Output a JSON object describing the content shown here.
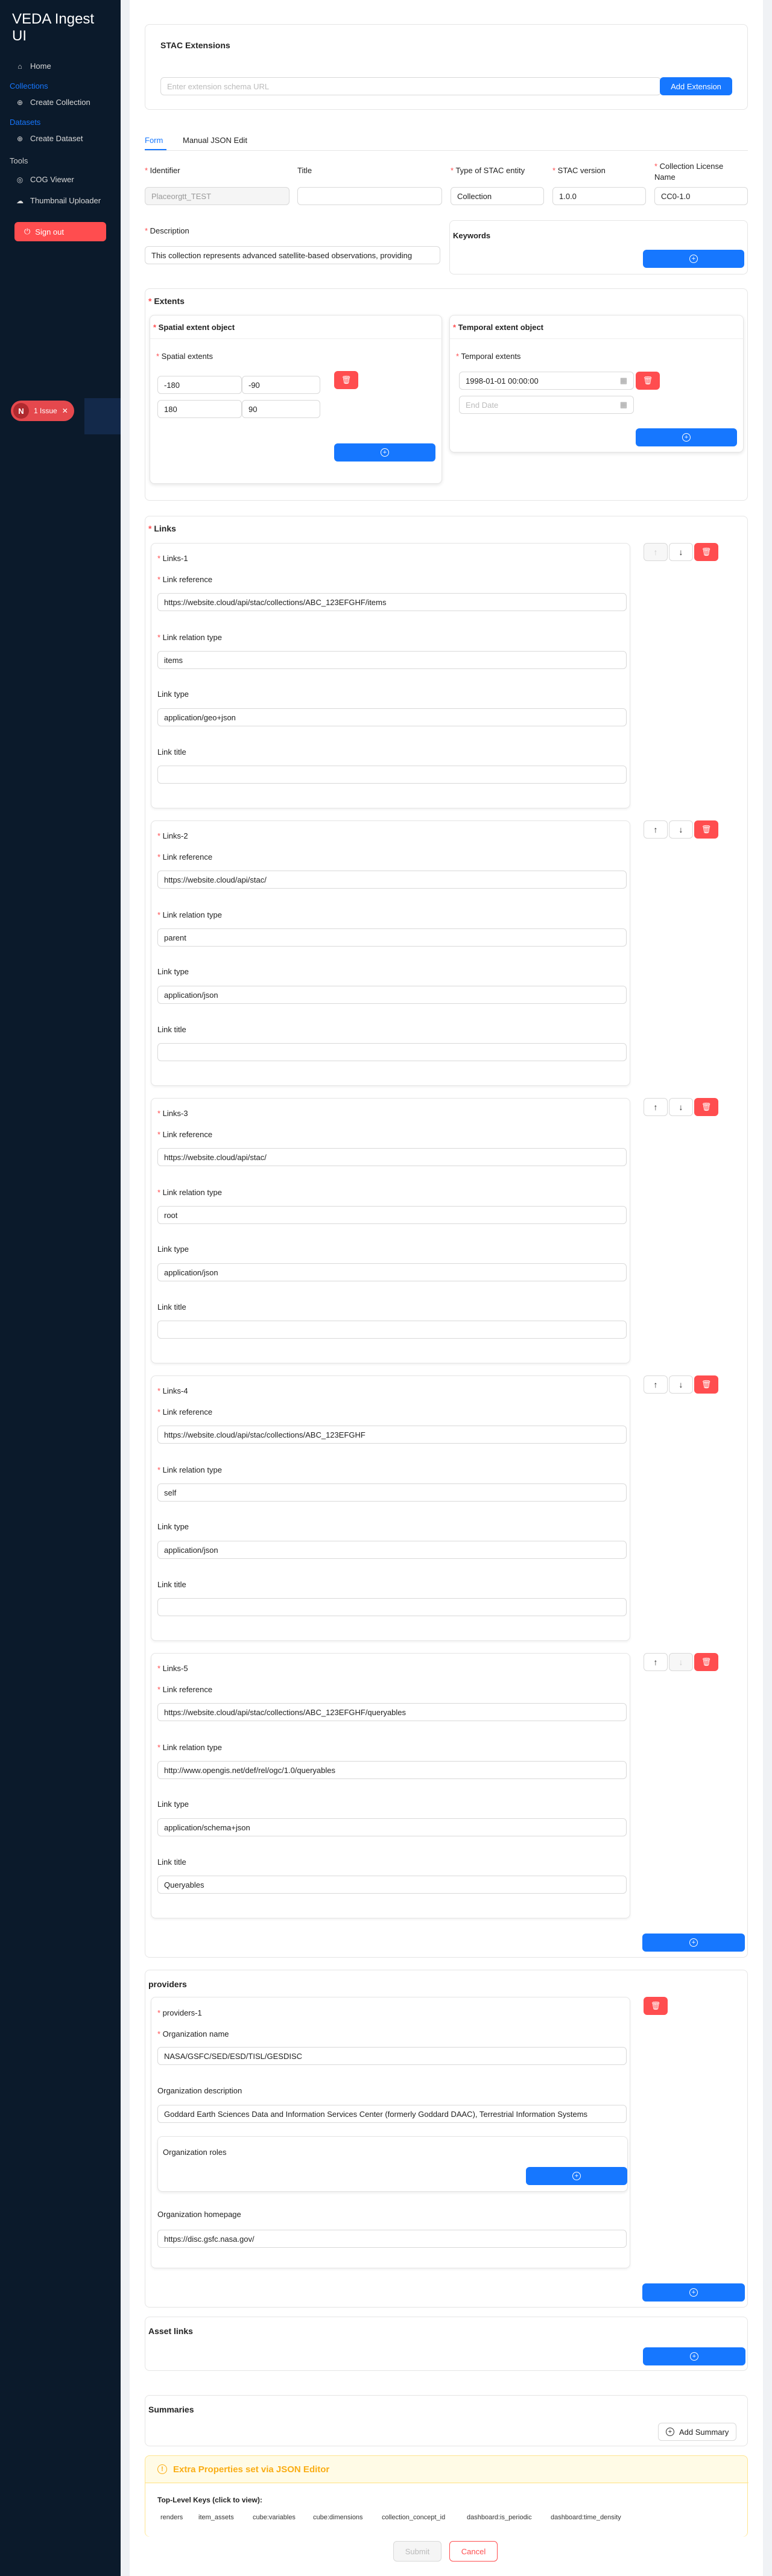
{
  "sidebar": {
    "app_title": "VEDA Ingest UI",
    "items": [
      {
        "type": "item",
        "label": "Home",
        "icon": "home-icon"
      },
      {
        "type": "group",
        "label": "Collections"
      },
      {
        "type": "item",
        "label": "Create Collection",
        "icon": "plus-circle-icon"
      },
      {
        "type": "group",
        "label": "Datasets"
      },
      {
        "type": "item",
        "label": "Create Dataset",
        "icon": "plus-circle-icon"
      },
      {
        "type": "label",
        "label": "Tools"
      },
      {
        "type": "item",
        "label": "COG Viewer",
        "icon": "globe-icon"
      },
      {
        "type": "item",
        "label": "Thumbnail Uploader",
        "icon": "cloud-upload-icon"
      }
    ],
    "signout_label": "Sign out",
    "issue_badge": {
      "letter": "N",
      "text": "1 Issue"
    }
  },
  "stac_ext": {
    "title": "STAC Extensions",
    "placeholder": "Enter extension schema URL",
    "add_label": "Add Extension"
  },
  "tabs": {
    "form": "Form",
    "json": "Manual JSON Edit"
  },
  "fields": {
    "identifier_label": "Identifier",
    "identifier_value": "Placeorgtt_TEST",
    "title_label": "Title",
    "title_value": "",
    "type_label": "Type of STAC entity",
    "type_value": "Collection",
    "stac_version_label": "STAC version",
    "stac_version_value": "1.0.0",
    "license_label": "Collection License Name",
    "license_value": "CC0-1.0",
    "description_label": "Description",
    "description_value": "This collection represents advanced satellite-based observations, providing",
    "keywords_label": "Keywords"
  },
  "extents": {
    "title": "Extents",
    "spatial_title": "Spatial extent object",
    "spatial_label": "Spatial extents",
    "spatial_values": [
      "-180",
      "-90",
      "180",
      "90"
    ],
    "temporal_title": "Temporal extent object",
    "temporal_label": "Temporal extents",
    "start_date": "1998-01-01 00:00:00",
    "end_placeholder": "End Date"
  },
  "links": {
    "title": "Links",
    "ref_label": "Link reference",
    "rel_label": "Link relation type",
    "type_label": "Link type",
    "title_label": "Link title",
    "items": [
      {
        "name": "Links-1",
        "href": "https://website.cloud/api/stac/collections/ABC_123EFGHF/items",
        "rel": "items",
        "type": "application/geo+json",
        "title": ""
      },
      {
        "name": "Links-2",
        "href": "https://website.cloud/api/stac/",
        "rel": "parent",
        "type": "application/json",
        "title": ""
      },
      {
        "name": "Links-3",
        "href": "https://website.cloud/api/stac/",
        "rel": "root",
        "type": "application/json",
        "title": ""
      },
      {
        "name": "Links-4",
        "href": "https://website.cloud/api/stac/collections/ABC_123EFGHF",
        "rel": "self",
        "type": "application/json",
        "title": ""
      },
      {
        "name": "Links-5",
        "href": "https://website.cloud/api/stac/collections/ABC_123EFGHF/queryables",
        "rel": "http://www.opengis.net/def/rel/ogc/1.0/queryables",
        "type": "application/schema+json",
        "title": "Queryables"
      }
    ]
  },
  "providers": {
    "title": "providers",
    "item_name": "providers-1",
    "org_name_label": "Organization name",
    "org_name_value": "NASA/GSFC/SED/ESD/TISL/GESDISC",
    "org_desc_label": "Organization description",
    "org_desc_value": "Goddard Earth Sciences Data and Information Services Center (formerly Goddard DAAC), Terrestrial Information Systems",
    "org_roles_label": "Organization roles",
    "org_home_label": "Organization homepage",
    "org_home_value": "https://disc.gsfc.nasa.gov/"
  },
  "asset_links": {
    "title": "Asset links"
  },
  "summaries": {
    "title": "Summaries",
    "add_label": "Add Summary"
  },
  "extra": {
    "title": "Extra Properties set via JSON Editor",
    "keys_label": "Top-Level Keys (click to view):",
    "keys": [
      "renders",
      "item_assets",
      "cube:variables",
      "cube:dimensions",
      "collection_concept_id",
      "dashboard:is_periodic",
      "dashboard:time_density"
    ]
  },
  "footer": {
    "submit": "Submit",
    "cancel": "Cancel"
  },
  "colors": {
    "primary": "#1677ff",
    "danger": "#ff4d4f",
    "sidebar_bg": "#0b1a2b"
  }
}
